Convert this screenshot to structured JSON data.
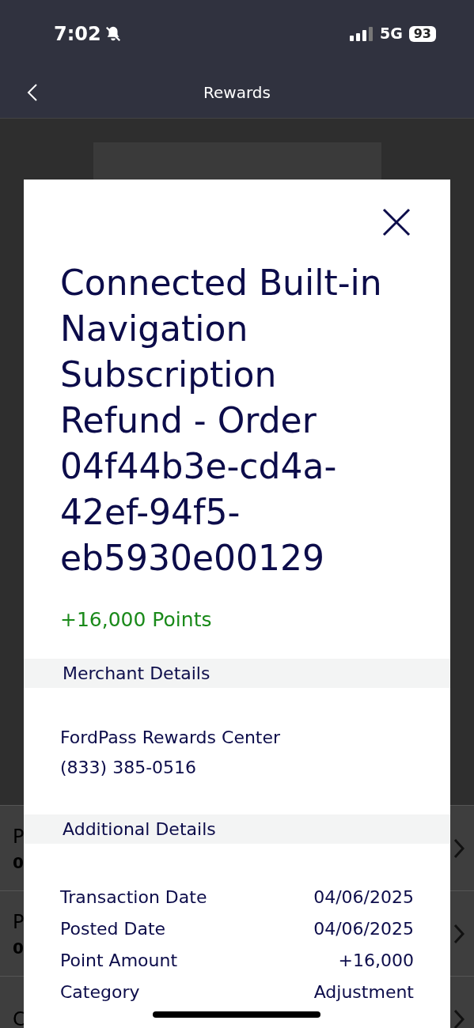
{
  "status_bar": {
    "time": "7:02",
    "network": "5G",
    "battery": "93"
  },
  "header": {
    "title": "Rewards"
  },
  "background": {
    "rows": [
      {
        "title": "P",
        "subtitle": "0"
      },
      {
        "title": "P",
        "subtitle": "0"
      },
      {
        "title": "C"
      }
    ]
  },
  "modal": {
    "title": "Connected Built-in Navigation Subscription Refund - Order 04f44b3e-cd4a-42ef-94f5-eb5930e00129",
    "points": "+16,000 Points",
    "sections": [
      {
        "heading": "Merchant Details",
        "lines": [
          "FordPass Rewards Center",
          "(833) 385-0516"
        ]
      },
      {
        "heading": "Additional Details",
        "details": [
          {
            "label": "Transaction Date",
            "value": "04/06/2025"
          },
          {
            "label": "Posted Date",
            "value": "04/06/2025"
          },
          {
            "label": "Point Amount",
            "value": "+16,000"
          },
          {
            "label": "Category",
            "value": "Adjustment"
          }
        ]
      }
    ]
  }
}
